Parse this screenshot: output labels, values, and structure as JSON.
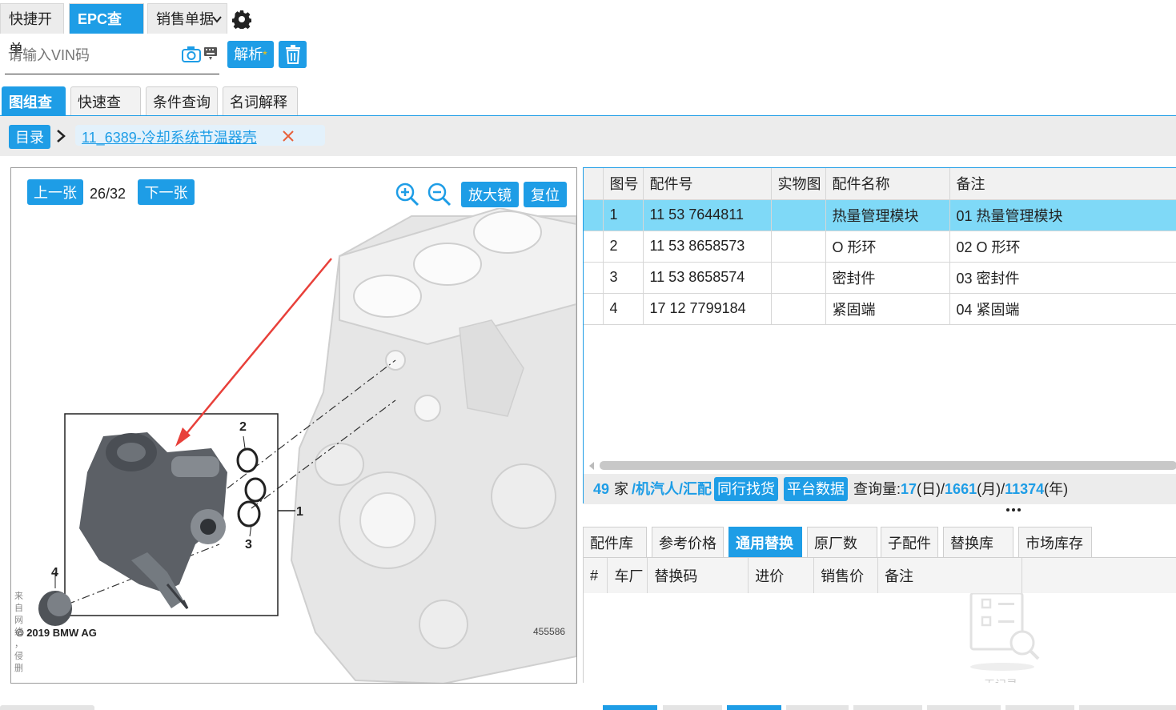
{
  "top_tabs": [
    {
      "label": "快捷开单"
    },
    {
      "label": "EPC查询"
    },
    {
      "label": "销售单据"
    }
  ],
  "vin": {
    "placeholder": "请输入VIN码",
    "parse_label": "解析",
    "asterisk": "*"
  },
  "sub_tabs": [
    {
      "label": "图组查询"
    },
    {
      "label": "快速查询"
    },
    {
      "label": "条件查询"
    },
    {
      "label": "名词解释"
    }
  ],
  "breadcrumb": {
    "root": "目录",
    "current": "11_6389-冷却系统节温器壳"
  },
  "viewer": {
    "prev": "上一张",
    "counter": "26/32",
    "next": "下一张",
    "magnifier": "放大镜",
    "reset": "复位",
    "copyright": "© 2019 BMW AG",
    "image_no": "455586",
    "callouts": [
      "1",
      "2",
      "3",
      "4"
    ],
    "side_note": "来自网络，侵删"
  },
  "parts_table": {
    "headers": [
      "图号",
      "配件号",
      "实物图",
      "配件名称",
      "备注"
    ],
    "rows": [
      {
        "no": "1",
        "part": "11 53 7644811",
        "photo": "",
        "name": "热量管理模块",
        "note": "01 热量管理模块"
      },
      {
        "no": "2",
        "part": "11 53 8658573",
        "photo": "",
        "name": "O 形环",
        "note": "02 O 形环"
      },
      {
        "no": "3",
        "part": "11 53 8658574",
        "photo": "",
        "name": "密封件",
        "note": "03 密封件"
      },
      {
        "no": "4",
        "part": "17 12 7799184",
        "photo": "",
        "name": "紧固端",
        "note": "04 紧固端"
      }
    ]
  },
  "stats": {
    "count": "49",
    "count_unit": "家",
    "sources": "/机汽人/汇配",
    "peer_btn": "同行找货",
    "platform_btn": "平台数据",
    "query_label": "查询量:",
    "day": "17",
    "day_unit": "(日)/",
    "month": "1661",
    "month_unit": "(月)/",
    "year": "11374",
    "year_unit": "(年)"
  },
  "bottom_tabs": [
    {
      "label": "配件库存"
    },
    {
      "label": "参考价格"
    },
    {
      "label": "通用替换"
    },
    {
      "label": "原厂数据"
    },
    {
      "label": "子配件"
    },
    {
      "label": "替换库存"
    },
    {
      "label": "市场库存"
    }
  ],
  "sub_table_headers": [
    "#",
    "车厂",
    "替换码",
    "进价",
    "销售价",
    "备注"
  ],
  "empty_text": "无记录",
  "colors": {
    "accent": "#1e9de6",
    "selected_row": "#7fd9f7",
    "arrow": "#e8403a"
  }
}
